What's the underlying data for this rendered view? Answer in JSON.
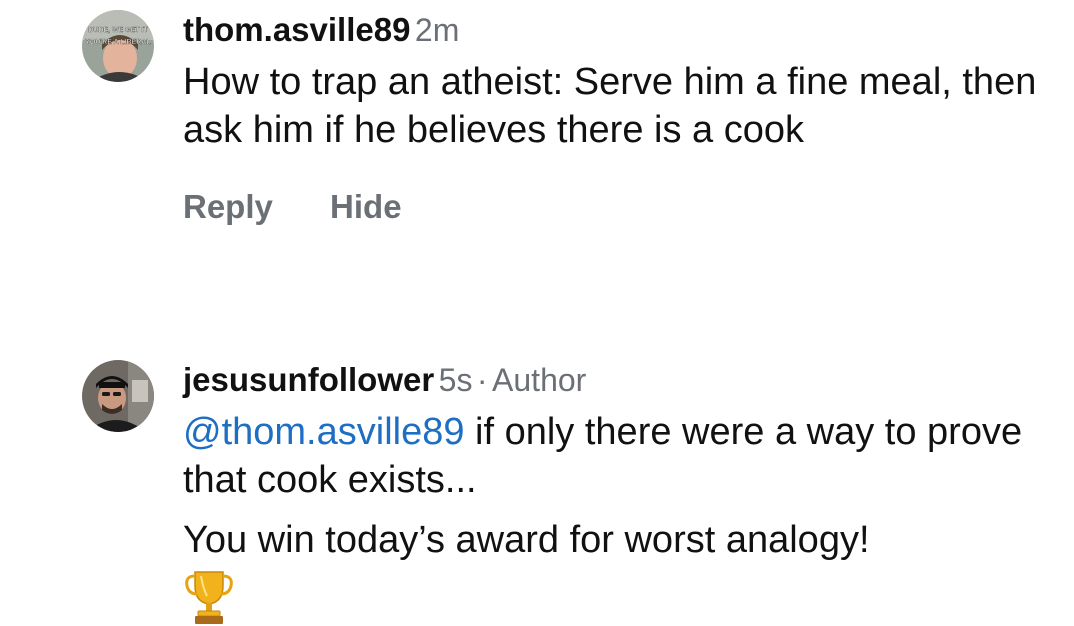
{
  "comments": [
    {
      "username": "thom.asville89",
      "time": "2m",
      "text": "How to trap an atheist: Serve him a fine meal, then ask him if he believes there is a cook",
      "reply_label": "Reply",
      "hide_label": "Hide",
      "avatar_caption_line1": "DUDE, WE GET IT",
      "avatar_caption_line2": "YOU'RE A LIBERAL"
    },
    {
      "username": "jesusunfollower",
      "time": "5s",
      "separator": "·",
      "badge": "Author",
      "mention": "@thom.asville89",
      "text_after_mention": " if only there were a way to prove that cook exists...",
      "text2": "You win today’s award for worst analogy!",
      "emoji_icon": "trophy-icon"
    }
  ],
  "colors": {
    "text": "#111111",
    "secondary": "#6b6f76",
    "mention": "#1e6fc4"
  }
}
